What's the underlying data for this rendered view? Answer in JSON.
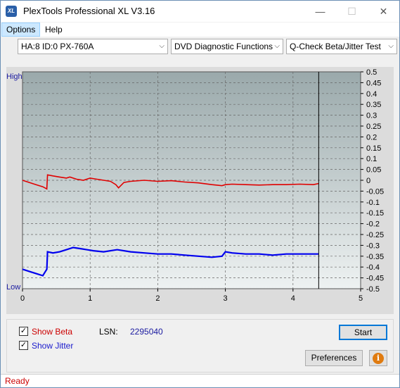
{
  "window": {
    "title": "PlexTools Professional XL V3.16",
    "icon_text": "XL",
    "minimize": "—",
    "maximize": "☐",
    "close": "✕"
  },
  "menu": {
    "options": "Options",
    "help": "Help"
  },
  "toolbar": {
    "drive": "HA:8 ID:0  PX-760A",
    "function": "DVD Diagnostic Functions",
    "test": "Q-Check Beta/Jitter Test"
  },
  "chart_data": {
    "type": "line",
    "left_labels": {
      "high": "High",
      "low": "Low"
    },
    "xlim": [
      0,
      5
    ],
    "x_ticks": [
      "0",
      "1",
      "2",
      "3",
      "4",
      "5"
    ],
    "ylim": [
      -0.5,
      0.5
    ],
    "y_ticks": [
      "0.5",
      "0.45",
      "0.4",
      "0.35",
      "0.3",
      "0.25",
      "0.2",
      "0.15",
      "0.1",
      "0.05",
      "0",
      "-0.05",
      "-0.1",
      "-0.15",
      "-0.2",
      "-0.25",
      "-0.3",
      "-0.35",
      "-0.4",
      "-0.45",
      "-0.5"
    ],
    "cursor_x": 4.38,
    "series": [
      {
        "color": "#e00000",
        "x": [
          0,
          0.1,
          0.2,
          0.3,
          0.36,
          0.37,
          0.45,
          0.55,
          0.65,
          0.7,
          0.8,
          0.9,
          1.0,
          1.1,
          1.2,
          1.3,
          1.38,
          1.42,
          1.5,
          1.6,
          1.8,
          2.0,
          2.2,
          2.4,
          2.6,
          2.8,
          2.95,
          3.0,
          3.1,
          3.3,
          3.5,
          3.7,
          3.9,
          4.1,
          4.3,
          4.38
        ],
        "y": [
          0.0,
          -0.01,
          -0.02,
          -0.03,
          -0.04,
          0.025,
          0.02,
          0.015,
          0.01,
          0.015,
          0.005,
          0.0,
          0.01,
          0.005,
          0.0,
          -0.005,
          -0.02,
          -0.035,
          -0.01,
          -0.005,
          0.0,
          -0.005,
          -0.002,
          -0.008,
          -0.012,
          -0.02,
          -0.025,
          -0.02,
          -0.018,
          -0.02,
          -0.022,
          -0.02,
          -0.02,
          -0.018,
          -0.02,
          -0.015
        ]
      },
      {
        "color": "#0000ee",
        "x": [
          0,
          0.1,
          0.2,
          0.3,
          0.36,
          0.37,
          0.45,
          0.55,
          0.65,
          0.75,
          0.85,
          0.95,
          1.05,
          1.2,
          1.4,
          1.6,
          1.8,
          2.0,
          2.2,
          2.4,
          2.6,
          2.8,
          2.95,
          3.0,
          3.1,
          3.3,
          3.5,
          3.7,
          3.9,
          4.1,
          4.3,
          4.38
        ],
        "y": [
          -0.41,
          -0.42,
          -0.43,
          -0.44,
          -0.41,
          -0.33,
          -0.335,
          -0.33,
          -0.32,
          -0.31,
          -0.315,
          -0.32,
          -0.325,
          -0.33,
          -0.32,
          -0.33,
          -0.335,
          -0.34,
          -0.34,
          -0.345,
          -0.35,
          -0.355,
          -0.35,
          -0.33,
          -0.335,
          -0.34,
          -0.34,
          -0.345,
          -0.34,
          -0.34,
          -0.34,
          -0.34
        ]
      }
    ]
  },
  "bottom": {
    "show_beta": "Show Beta",
    "show_jitter": "Show Jitter",
    "show_beta_checked": true,
    "show_jitter_checked": true,
    "lsn_label": "LSN:",
    "lsn_value": "2295040",
    "start": "Start",
    "preferences": "Preferences",
    "info_icon": "i"
  },
  "status": {
    "text": "Ready"
  },
  "colors": {
    "beta": "#cc0000",
    "jitter": "#0000cc",
    "plot_top": "#9aa9ab",
    "plot_bottom": "#e6ecec"
  }
}
